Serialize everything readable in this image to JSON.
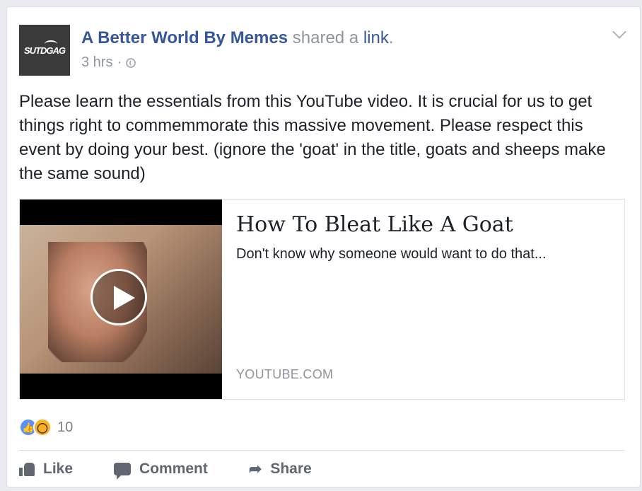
{
  "post": {
    "avatar_text": "SUTDGAG",
    "page_name": "A Better World By Memes",
    "shared_text": "shared a",
    "link_word": "link",
    "period": ".",
    "time": "3 hrs",
    "separator": "·",
    "body": "Please learn the essentials from this YouTube video. It is crucial for us to get things right to commemmorate this massive movement. Please respect this event by doing your best. (ignore the 'goat' in the title, goats and sheeps make the same sound)"
  },
  "link_card": {
    "title": "How To Bleat Like A Goat",
    "description": "Don't know why someone would want to do that...",
    "domain": "YOUTUBE.COM"
  },
  "reactions": {
    "count": "10",
    "types": [
      "like-icon",
      "wow-icon"
    ],
    "like_color": "#5890ff",
    "wow_color": "#f7b125"
  },
  "actions": {
    "like": "Like",
    "comment": "Comment",
    "share": "Share"
  },
  "colors": {
    "link_blue": "#365899",
    "muted_gray": "#90949c",
    "text": "#1d2129"
  }
}
